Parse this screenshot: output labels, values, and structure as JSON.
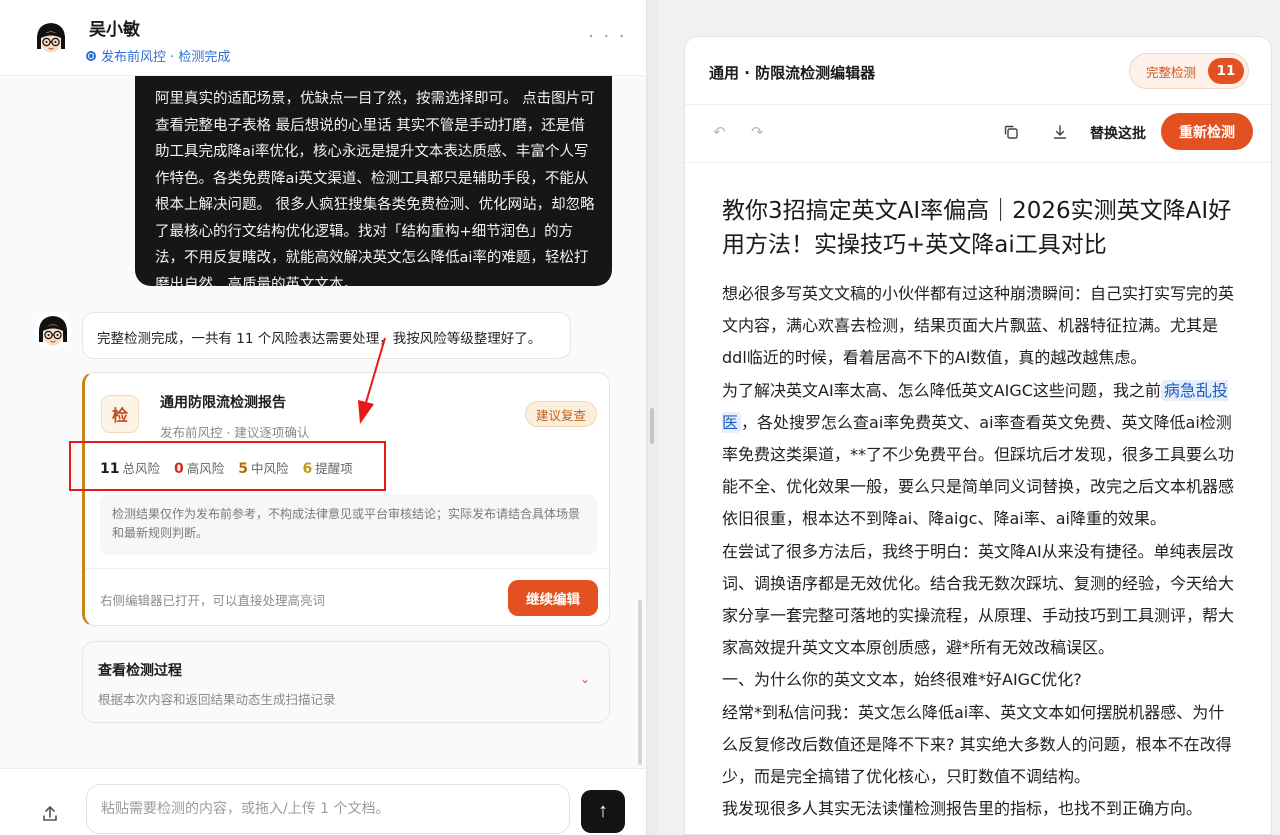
{
  "header": {
    "name": "吴小敏",
    "status": "发布前风控 · 检测完成",
    "more": "· · ·"
  },
  "user_message": "阿里真实的适配场景，优缺点一目了然，按需选择即可。 点击图片可查看完整电子表格 最后想说的心里话 其实不管是手动打磨，还是借助工具完成降ai率优化，核心永远是提升文本表达质感、丰富个人写作特色。各类免费降ai英文渠道、检测工具都只是辅助手段，不能从根本上解决问题。 很多人疯狂搜集各类免费检测、优化网站，却忽略了最核心的行文结构优化逻辑。找对「结构重构+细节润色」的方法，不用反复瞎改，就能高效解决英文怎么降低ai率的难题，轻松打磨出自然、高质量的英文文本。",
  "bot_message": "完整检测完成，一共有 11 个风险表达需要处理，我按风险等级整理好了。",
  "report": {
    "icon_char": "检",
    "title": "通用防限流检测报告",
    "subtitle": "发布前风控 · 建议逐项确认",
    "badge": "建议复查",
    "stats": [
      {
        "value": "11",
        "label": "总风险",
        "color": "#1f1f1f"
      },
      {
        "value": "0",
        "label": "高风险",
        "color": "#d42a1e"
      },
      {
        "value": "5",
        "label": "中风险",
        "color": "#b86a12"
      },
      {
        "value": "6",
        "label": "提醒项",
        "color": "#c29a12"
      }
    ],
    "disclaimer": "检测结果仅作为发布前参考，不构成法律意见或平台审核结论；实际发布请结合具体场景和最新规则判断。",
    "footer_note": "右侧编辑器已打开，可以直接处理高亮词",
    "continue_label": "继续编辑"
  },
  "process": {
    "title": "查看检测过程",
    "subtitle": "根据本次内容和返回结果动态生成扫描记录",
    "chevron": "⌄"
  },
  "composer": {
    "placeholder": "粘贴需要检测的内容，或拖入/上传 1 个文档。",
    "send": "↑"
  },
  "editor": {
    "title": "通用 · 防限流检测编辑器",
    "full_check_label": "完整检测",
    "full_check_count": "11",
    "undo": "↶",
    "redo": "↷",
    "replace_label": "替换这批",
    "recheck_label": "重新检测",
    "doc_title": "教你3招搞定英文AI率偏高｜2026实测英文降AI好用方法！实操技巧+英文降ai工具对比",
    "p1": "想必很多写英文文稿的小伙伴都有过这种崩溃瞬间：自己实打实写完的英文内容，满心欢喜去检测，结果页面大片飘蓝、机器特征拉满。尤其是ddl临近的时候，看着居高不下的AI数值，真的越改越焦虑。",
    "p2_before": "为了解决英文AI率太高、怎么降低英文AIGC这些问题，我之前",
    "p2_highlight": "病急乱投医",
    "p2_after": "，各处搜罗怎么查ai率免费英文、ai率查看英文免费、英文降低ai检测率免费这类渠道，**了不少免费平台。但踩坑后才发现，很多工具要么功能不全、优化效果一般，要么只是简单同义词替换，改完之后文本机器感依旧很重，根本达不到降ai、降aigc、降ai率、ai降重的效果。",
    "p3": "在尝试了很多方法后，我终于明白：英文降AI从来没有捷径。单纯表层改词、调换语序都是无效优化。结合我无数次踩坑、复测的经验，今天给大家分享一套完整可落地的实操流程，从原理、手动技巧到工具测评，帮大家高效提升英文文本原创质感，避*所有无效改稿误区。",
    "p4": "一、为什么你的英文文本，始终很难*好AIGC优化?",
    "p5": "经常*到私信问我：英文怎么降低ai率、英文文本如何摆脱机器感、为什么反复修改后数值还是降不下来? 其实绝大多数人的问题，根本不在改得少，而是完全搞错了优化核心，只盯数值不调结构。",
    "p6": "我发现很多人其实无法读懂检测报告里的指标，也找不到正确方向。"
  },
  "colors": {
    "accent": "#e2511f",
    "status_blue": "#2e6fd6",
    "annotation_red": "#e61818",
    "card_border_gold": "#c8871c"
  }
}
